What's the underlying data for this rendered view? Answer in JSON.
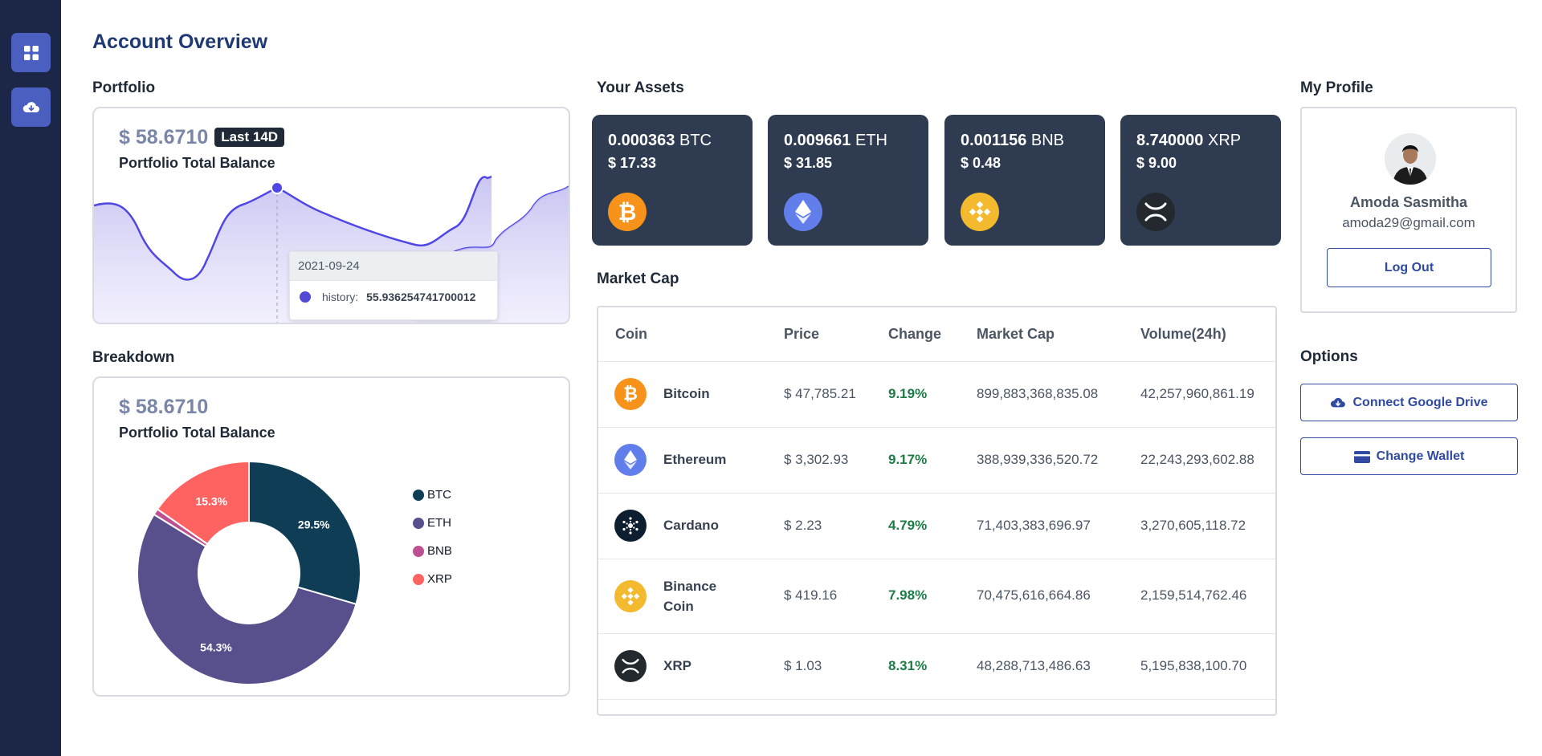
{
  "rail": {
    "items": [
      {
        "icon": "dashboard-grid-icon"
      },
      {
        "icon": "cloud-download-icon"
      }
    ]
  },
  "page_title": "Account Overview",
  "portfolio": {
    "section_title": "Portfolio",
    "balance": "$ 58.6710",
    "period_badge": "Last 14D",
    "label": "Portfolio Total Balance",
    "tooltip": {
      "date": "2021-09-24",
      "series_label": "history:",
      "value": "55.936254741700012"
    },
    "colors": {
      "line": "#4f46e5",
      "fill": "#c7c3f2"
    }
  },
  "breakdown": {
    "section_title": "Breakdown",
    "balance": "$ 58.6710",
    "label": "Portfolio Total Balance",
    "legend": [
      {
        "name": "BTC",
        "color": "#0f3d56"
      },
      {
        "name": "ETH",
        "color": "#58508d"
      },
      {
        "name": "BNB",
        "color": "#bc5090"
      },
      {
        "name": "XRP",
        "color": "#ff6361"
      }
    ]
  },
  "chart_data": {
    "type": "pie",
    "categories": [
      "BTC",
      "ETH",
      "BNB",
      "XRP"
    ],
    "values": [
      29.5,
      54.3,
      0.9,
      15.3
    ],
    "data_labels": [
      "29.5%",
      "54.3%",
      "",
      "15.3%"
    ],
    "colors": [
      "#0f3d56",
      "#58508d",
      "#bc5090",
      "#ff6361"
    ],
    "legend_position": "right"
  },
  "assets": {
    "section_title": "Your Assets",
    "items": [
      {
        "amount": "0.000363",
        "symbol": "BTC",
        "usd": "$ 17.33",
        "icon": "bitcoin-icon",
        "color": "#f7931a"
      },
      {
        "amount": "0.009661",
        "symbol": "ETH",
        "usd": "$ 31.85",
        "icon": "ethereum-icon",
        "color": "#627eea"
      },
      {
        "amount": "0.001156",
        "symbol": "BNB",
        "usd": "$ 0.48",
        "icon": "binance-icon",
        "color": "#f3ba2f"
      },
      {
        "amount": "8.740000",
        "symbol": "XRP",
        "usd": "$ 9.00",
        "icon": "xrp-icon",
        "color": "#23292f"
      }
    ]
  },
  "market_cap": {
    "section_title": "Market Cap",
    "columns": [
      "Coin",
      "Price",
      "Change",
      "Market Cap",
      "Volume(24h)"
    ],
    "rows": [
      {
        "coin": "Bitcoin",
        "price": "$ 47,785.21",
        "change": "9.19%",
        "market_cap": "899,883,368,835.08",
        "volume": "42,257,960,861.19",
        "icon": "bitcoin-icon",
        "color": "#f7931a"
      },
      {
        "coin": "Ethereum",
        "price": "$ 3,302.93",
        "change": "9.17%",
        "market_cap": "388,939,336,520.72",
        "volume": "22,243,293,602.88",
        "icon": "ethereum-icon",
        "color": "#627eea"
      },
      {
        "coin": "Cardano",
        "price": "$ 2.23",
        "change": "4.79%",
        "market_cap": "71,403,383,696.97",
        "volume": "3,270,605,118.72",
        "icon": "cardano-icon",
        "color": "#0d1e30"
      },
      {
        "coin": "Binance Coin",
        "price": "$ 419.16",
        "change": "7.98%",
        "market_cap": "70,475,616,664.86",
        "volume": "2,159,514,762.46",
        "icon": "binance-icon",
        "color": "#f3ba2f"
      },
      {
        "coin": "XRP",
        "price": "$ 1.03",
        "change": "8.31%",
        "market_cap": "48,288,713,486.63",
        "volume": "5,195,838,100.70",
        "icon": "xrp-icon",
        "color": "#23292f"
      }
    ]
  },
  "profile": {
    "section_title": "My Profile",
    "name": "Amoda Sasmitha",
    "email": "amoda29@gmail.com",
    "logout_label": "Log Out"
  },
  "options": {
    "section_title": "Options",
    "connect_drive_label": "Connect Google Drive",
    "change_wallet_label": "Change Wallet"
  }
}
